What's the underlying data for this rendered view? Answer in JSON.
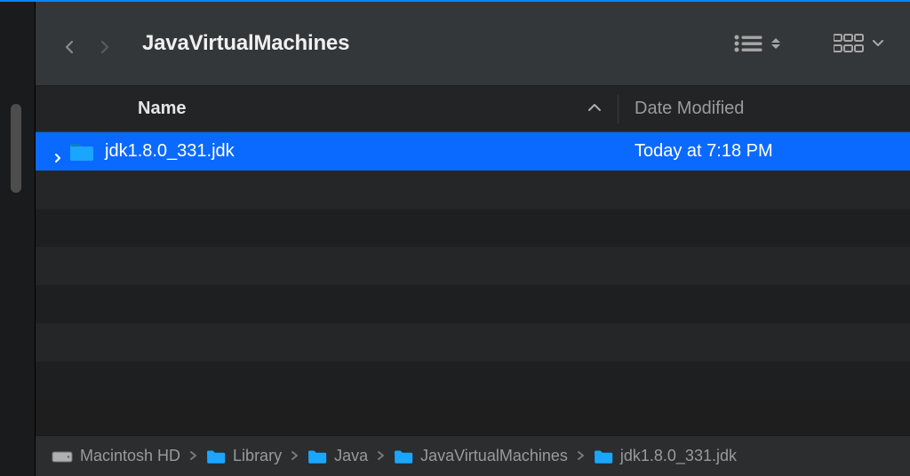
{
  "colors": {
    "selection": "#0a6aff",
    "folder": "#1aa6ff",
    "window_top_accent": "#0a84ff"
  },
  "toolbar": {
    "title": "JavaVirtualMachines"
  },
  "columns": {
    "name": "Name",
    "date": "Date Modified",
    "sort_direction": "ascending"
  },
  "rows": [
    {
      "name": "jdk1.8.0_331.jdk",
      "date_modified": "Today at 7:18 PM",
      "icon": "folder",
      "expandable": true,
      "selected": true
    }
  ],
  "pathbar": [
    {
      "icon": "hdd",
      "label": "Macintosh HD"
    },
    {
      "icon": "folder",
      "label": "Library"
    },
    {
      "icon": "folder",
      "label": "Java"
    },
    {
      "icon": "folder",
      "label": "JavaVirtualMachines"
    },
    {
      "icon": "folder",
      "label": "jdk1.8.0_331.jdk"
    }
  ]
}
